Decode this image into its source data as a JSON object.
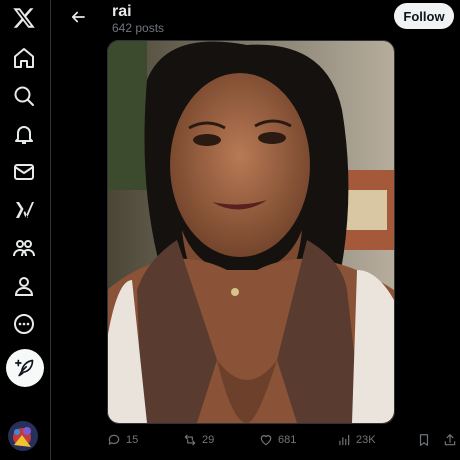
{
  "nav": {
    "items": [
      {
        "name": "x-logo-icon"
      },
      {
        "name": "home-icon"
      },
      {
        "name": "search-icon"
      },
      {
        "name": "notifications-icon"
      },
      {
        "name": "messages-icon"
      },
      {
        "name": "grok-icon"
      },
      {
        "name": "communities-icon"
      },
      {
        "name": "profile-icon"
      },
      {
        "name": "more-icon"
      }
    ],
    "compose_icon": "feather-plus-icon"
  },
  "header": {
    "name": "rai",
    "post_count": "642 posts",
    "follow_label": "Follow"
  },
  "post": {
    "media_alt": "photo",
    "replies": "15",
    "reposts": "29",
    "likes": "681",
    "views": "23K"
  },
  "colors": {
    "background": "#000000",
    "text_primary": "#e7e9ea",
    "text_secondary": "#71767b",
    "border": "#2f3336",
    "follow_bg": "#eff3f4"
  }
}
